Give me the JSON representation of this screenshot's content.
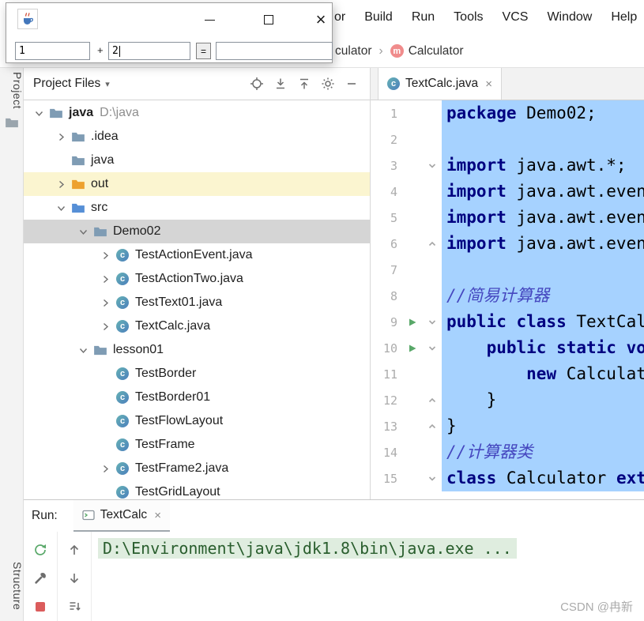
{
  "app": {
    "watermark": "CSDN @冉新"
  },
  "colors": {
    "selection": "#A6D2FF",
    "keyword": "#000080",
    "comment": "#4547BF",
    "run-green": "#59A869",
    "stop-red": "#DB5C5C",
    "folder": "#7F9CB4",
    "folder-out": "#EDA12F",
    "folder-src": "#568FD6",
    "row-selected": "#D5D5D5",
    "row-highlight": "#FBF5D0",
    "console-cmd-bg": "#DFEDDF",
    "console-cmd-fg": "#2A5E2E",
    "method-pink": "#F08C8C",
    "class-a": "#66B2B5",
    "class-b": "#4B7FBC"
  },
  "calc_window": {
    "field1": "1",
    "operator": "+",
    "field2": "2",
    "equals_label": "=",
    "result": "",
    "controls": {
      "close_glyph": "×"
    }
  },
  "menubar": {
    "items": [
      "or",
      "Build",
      "Run",
      "Tools",
      "VCS",
      "Window",
      "Help"
    ]
  },
  "breadcrumbs": {
    "separator": "›",
    "items": [
      {
        "label": "culator"
      },
      {
        "label": "Calculator",
        "icon": "method"
      }
    ]
  },
  "tool_strip": {
    "project_label": "Project",
    "structure_label": "Structure"
  },
  "project_panel": {
    "header": {
      "title": "Project Files",
      "toolbar": [
        "locate",
        "expand-all",
        "collapse-all",
        "settings",
        "hide"
      ]
    },
    "tree": [
      {
        "label": "java",
        "suffix": "D:\\java",
        "level": 0,
        "chevron": "down",
        "icon": "folder",
        "bold": true
      },
      {
        "label": ".idea",
        "level": 1,
        "chevron": "right",
        "icon": "folder"
      },
      {
        "label": "java",
        "level": 1,
        "icon": "folder"
      },
      {
        "label": "out",
        "level": 1,
        "chevron": "right",
        "icon": "folder-out",
        "highlight": true
      },
      {
        "label": "src",
        "level": 1,
        "chevron": "down",
        "icon": "folder-src"
      },
      {
        "label": "Demo02",
        "level": 2,
        "chevron": "down",
        "icon": "folder",
        "selected": true
      },
      {
        "label": "TestActionEvent.java",
        "level": 3,
        "chevron": "right",
        "icon": "class"
      },
      {
        "label": "TestActionTwo.java",
        "level": 3,
        "chevron": "right",
        "icon": "class"
      },
      {
        "label": "TestText01.java",
        "level": 3,
        "chevron": "right",
        "icon": "class"
      },
      {
        "label": "TextCalc.java",
        "level": 3,
        "chevron": "right",
        "icon": "class"
      },
      {
        "label": "lesson01",
        "level": 2,
        "chevron": "down",
        "icon": "folder"
      },
      {
        "label": "TestBorder",
        "level": 3,
        "icon": "class"
      },
      {
        "label": "TestBorder01",
        "level": 3,
        "icon": "class"
      },
      {
        "label": "TestFlowLayout",
        "level": 3,
        "icon": "class"
      },
      {
        "label": "TestFrame",
        "level": 3,
        "icon": "class"
      },
      {
        "label": "TestFrame2.java",
        "level": 3,
        "chevron": "right",
        "icon": "class"
      },
      {
        "label": "TestGridLayout",
        "level": 3,
        "icon": "class"
      }
    ]
  },
  "editor": {
    "tab": {
      "label": "TextCalc.java",
      "close": "×"
    },
    "lines": [
      {
        "num": "1",
        "segments": [
          {
            "t": "package",
            "c": "k"
          },
          {
            "t": " Demo02;",
            "c": "p"
          }
        ]
      },
      {
        "num": "2",
        "segments": []
      },
      {
        "num": "3",
        "fold": "down",
        "segments": [
          {
            "t": "import",
            "c": "k"
          },
          {
            "t": " java.awt.*;",
            "c": "p"
          }
        ]
      },
      {
        "num": "4",
        "segments": [
          {
            "t": "import",
            "c": "k"
          },
          {
            "t": " java.awt.event",
            "c": "p"
          }
        ]
      },
      {
        "num": "5",
        "segments": [
          {
            "t": "import",
            "c": "k"
          },
          {
            "t": " java.awt.event",
            "c": "p"
          }
        ]
      },
      {
        "num": "6",
        "fold": "up",
        "segments": [
          {
            "t": "import",
            "c": "k"
          },
          {
            "t": " java.awt.event",
            "c": "p"
          }
        ]
      },
      {
        "num": "7",
        "segments": []
      },
      {
        "num": "8",
        "segments": [
          {
            "t": "//简易计算器",
            "c": "c"
          }
        ]
      },
      {
        "num": "9",
        "run": true,
        "fold": "down",
        "segments": [
          {
            "t": "public class",
            "c": "k"
          },
          {
            "t": " TextCalc",
            "c": "p"
          }
        ]
      },
      {
        "num": "10",
        "run": true,
        "fold": "down",
        "segments": [
          {
            "t": "    ",
            "c": "p"
          },
          {
            "t": "public static voi",
            "c": "k"
          }
        ]
      },
      {
        "num": "11",
        "segments": [
          {
            "t": "        ",
            "c": "p"
          },
          {
            "t": "new",
            "c": "k"
          },
          {
            "t": " Calculato",
            "c": "p"
          }
        ]
      },
      {
        "num": "12",
        "fold": "up",
        "segments": [
          {
            "t": "    }",
            "c": "p"
          }
        ]
      },
      {
        "num": "13",
        "fold": "up",
        "segments": [
          {
            "t": "}",
            "c": "p"
          }
        ]
      },
      {
        "num": "14",
        "segments": [
          {
            "t": "//计算器类",
            "c": "c"
          }
        ]
      },
      {
        "num": "15",
        "fold": "down",
        "segments": [
          {
            "t": "class",
            "c": "k"
          },
          {
            "t": " Calculator ",
            "c": "p"
          },
          {
            "t": "exte",
            "c": "k"
          }
        ]
      }
    ]
  },
  "run_panel": {
    "label": "Run:",
    "tab": {
      "label": "TextCalc",
      "close": "×"
    },
    "toolbar_left": [
      "rerun",
      "wrench",
      "stop"
    ],
    "toolbar_right": [
      "up-arrow",
      "down-arrow",
      "scroll-to-end"
    ],
    "console_line": "D:\\Environment\\java\\jdk1.8\\bin\\java.exe ..."
  }
}
